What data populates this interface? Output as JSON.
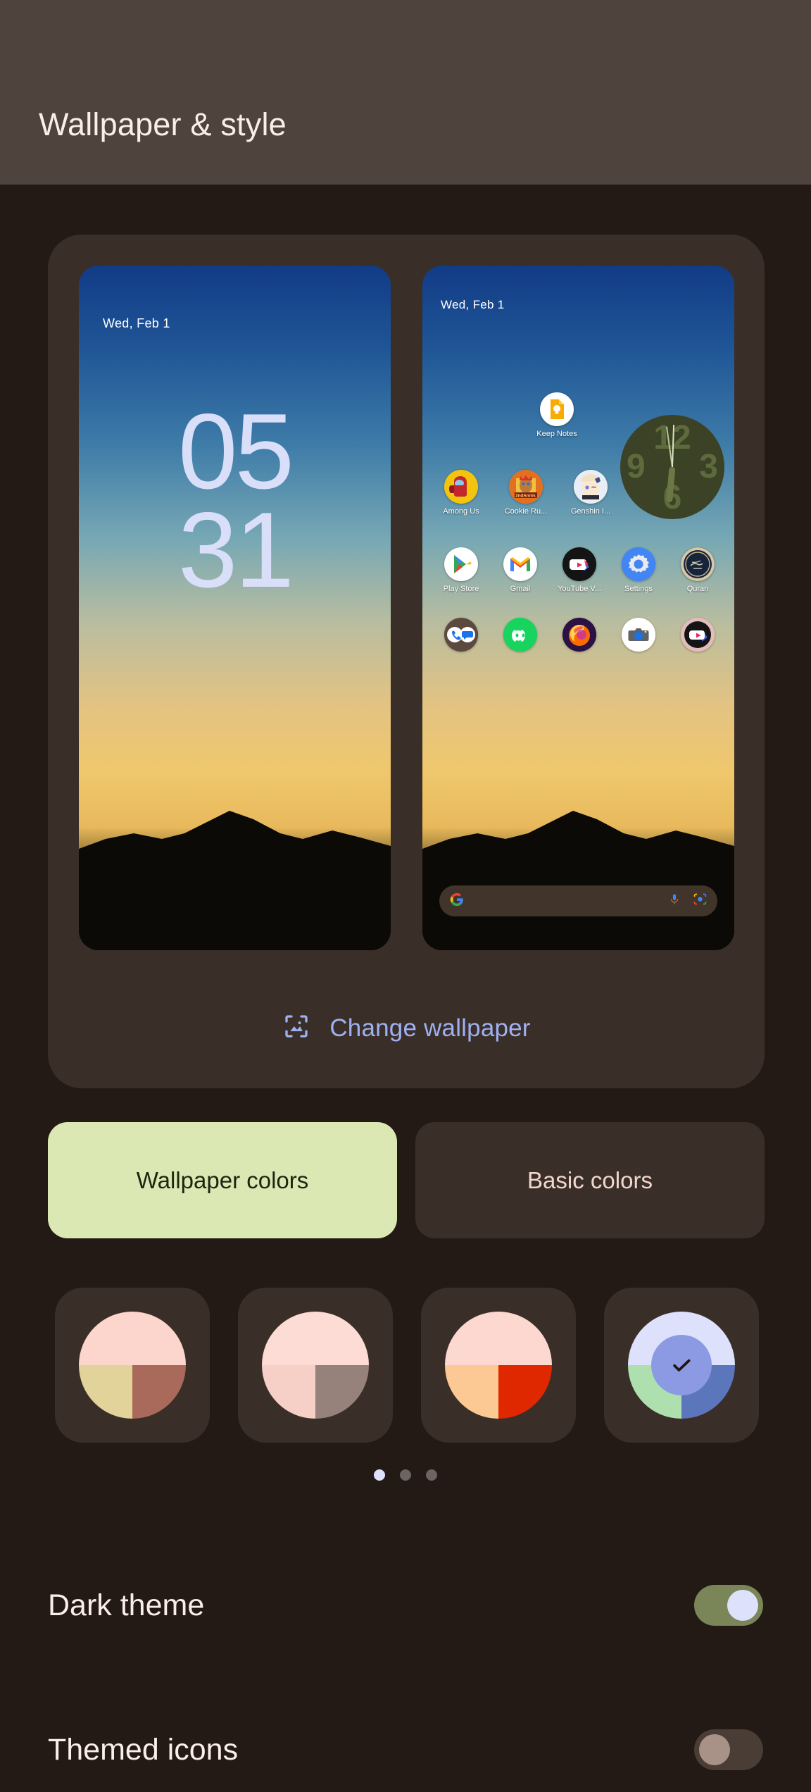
{
  "header": {
    "title": "Wallpaper & style",
    "bg": "#4f443d",
    "text": "#fbeee8"
  },
  "preview": {
    "lock_screen": {
      "date": "Wed, Feb 1",
      "clock_hours": "05",
      "clock_minutes": "31",
      "clock_color": "#d9def9"
    },
    "home_screen": {
      "date": "Wed, Feb 1",
      "clock_widget": {
        "numbers": [
          "12",
          "3",
          "6",
          "9"
        ],
        "face_color": "#3c4226"
      },
      "rows": [
        {
          "apps": [
            {
              "name": "Keep Notes",
              "icon": "keep-notes-icon"
            }
          ]
        },
        {
          "apps": [
            {
              "name": "Among Us",
              "icon": "among-us-icon"
            },
            {
              "name": "Cookie Ru...",
              "icon": "cookie-run-icon"
            },
            {
              "name": "Genshin I...",
              "icon": "genshin-impact-icon"
            }
          ]
        },
        {
          "apps": [
            {
              "name": "Play Store",
              "icon": "play-store-icon"
            },
            {
              "name": "Gmail",
              "icon": "gmail-icon"
            },
            {
              "name": "YouTube V...",
              "icon": "youtube-vanced-icon"
            },
            {
              "name": "Settings",
              "icon": "settings-icon"
            },
            {
              "name": "Quran",
              "icon": "quran-icon"
            }
          ]
        }
      ],
      "dock": [
        {
          "name": "Phone and Messages folder",
          "icon": "phone-messages-folder-icon"
        },
        {
          "name": "Discord",
          "icon": "discord-icon"
        },
        {
          "name": "Firefox",
          "icon": "firefox-icon"
        },
        {
          "name": "Camera",
          "icon": "camera-icon"
        },
        {
          "name": "YouTube Music",
          "icon": "youtube-music-icon"
        }
      ],
      "search_bar": {
        "logo": "google-g-icon",
        "mic": "microphone-icon",
        "lens": "google-lens-icon"
      }
    }
  },
  "change_wallpaper": {
    "label": "Change wallpaper",
    "icon": "image-frame-icon",
    "color": "#9fb0f2"
  },
  "tabs": [
    {
      "label": "Wallpaper colors",
      "selected": true,
      "bg": "#dce8b4",
      "fg": "#1f2410"
    },
    {
      "label": "Basic colors",
      "selected": false,
      "bg": "#3a2f28",
      "fg": "#f2d7cf"
    }
  ],
  "color_swatches": [
    {
      "name": "swatch-1",
      "selected": false,
      "top": "#fcd5cc",
      "bottom_left": "#e1d39a",
      "bottom_right": "#a96a5b"
    },
    {
      "name": "swatch-2",
      "selected": false,
      "top": "#fcdcd4",
      "bottom_left": "#f6cfc6",
      "bottom_right": "#97817b"
    },
    {
      "name": "swatch-3",
      "selected": false,
      "top": "#fcd8d0",
      "bottom_left": "#fcc995",
      "bottom_right": "#e02800"
    },
    {
      "name": "swatch-4",
      "selected": true,
      "top": "#dde1fb",
      "bottom_left": "#aedfae",
      "bottom_right": "#5c76bc",
      "inner": "#8b9ae2",
      "check": "#20160f"
    }
  ],
  "page_dots": {
    "count": 3,
    "active_index": 0,
    "active_color": "#dde1fb",
    "inactive_color": "#6b6460"
  },
  "settings_rows": [
    {
      "label": "Dark theme",
      "toggle": "on",
      "track": "#7a8558",
      "knob": "#dde1fb"
    },
    {
      "label": "Themed icons",
      "toggle": "off",
      "track": "#4a3d35",
      "knob": "#a89288"
    }
  ]
}
